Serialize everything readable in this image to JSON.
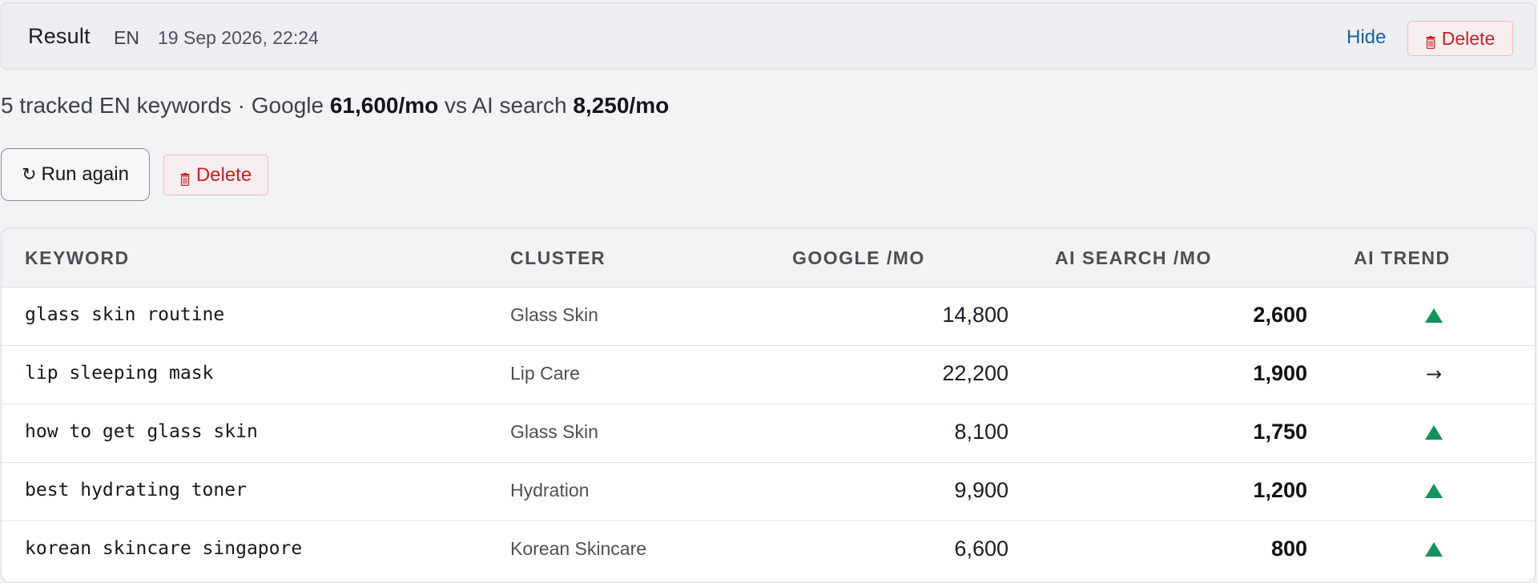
{
  "header": {
    "title": "Result",
    "lang": "EN",
    "timestamp": "19 Sep 2026, 22:24",
    "hide_label": "Hide",
    "delete_label": "Delete"
  },
  "summary": {
    "prefix": "5 tracked EN keywords · Google ",
    "google_total": "61,600/mo",
    "middle": " vs AI search ",
    "ai_total": "8,250/mo"
  },
  "actions": {
    "run_again_label": "Run again",
    "delete_label": "Delete"
  },
  "table": {
    "columns": [
      "KEYWORD",
      "CLUSTER",
      "GOOGLE /MO",
      "AI SEARCH /MO",
      "AI TREND"
    ],
    "rows": [
      {
        "keyword": "glass skin routine",
        "cluster": "Glass Skin",
        "google": "14,800",
        "ai": "2,600",
        "trend": "up"
      },
      {
        "keyword": "lip sleeping mask",
        "cluster": "Lip Care",
        "google": "22,200",
        "ai": "1,900",
        "trend": "flat"
      },
      {
        "keyword": "how to get glass skin",
        "cluster": "Glass Skin",
        "google": "8,100",
        "ai": "1,750",
        "trend": "up"
      },
      {
        "keyword": "best hydrating toner",
        "cluster": "Hydration",
        "google": "9,900",
        "ai": "1,200",
        "trend": "up"
      },
      {
        "keyword": "korean skincare singapore",
        "cluster": "Korean Skincare",
        "google": "6,600",
        "ai": "800",
        "trend": "up"
      }
    ],
    "trend_symbols": {
      "flat": "→"
    }
  },
  "colors": {
    "trend_up": "#14915c",
    "delete_red": "#cc1f1f",
    "link_blue": "#1d5fa0"
  },
  "icons": {
    "trend_up": "triangle-up-icon",
    "trend_flat": "arrow-right-icon",
    "delete": "trash-icon",
    "run_again": "refresh-icon"
  }
}
